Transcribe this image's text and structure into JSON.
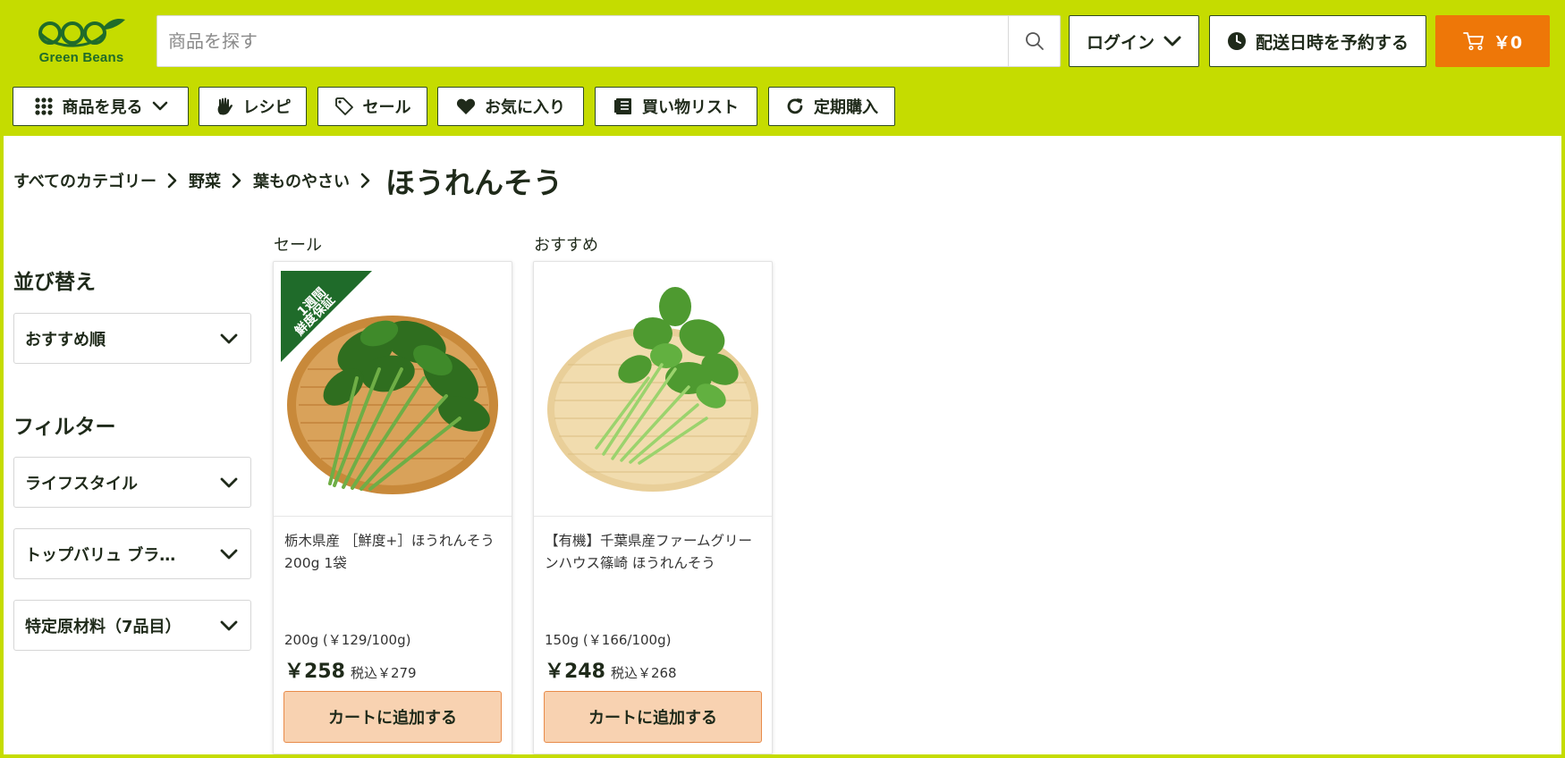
{
  "header": {
    "brand": "Green Beans",
    "search": {
      "placeholder": "商品を探す",
      "value": ""
    },
    "login_label": "ログイン",
    "reserve_label": "配送日時を予約する",
    "cart_total": "￥0"
  },
  "nav": [
    {
      "label": "商品を見る",
      "icon": "grid-icon"
    },
    {
      "label": "レシピ",
      "icon": "hand-icon"
    },
    {
      "label": "セール",
      "icon": "tag-icon"
    },
    {
      "label": "お気に入り",
      "icon": "heart-icon"
    },
    {
      "label": "買い物リスト",
      "icon": "list-icon"
    },
    {
      "label": "定期購入",
      "icon": "refresh-icon"
    }
  ],
  "breadcrumb": {
    "items": [
      "すべてのカテゴリー",
      "野菜",
      "葉ものやさい"
    ],
    "current": "ほうれんそう"
  },
  "sidebar": {
    "sort_heading": "並び替え",
    "sort_value": "おすすめ順",
    "filter_heading": "フィルター",
    "filters": [
      "ライフスタイル",
      "トップバリュ ブランド",
      "特定原材料（7品目）"
    ]
  },
  "products": [
    {
      "section_label": "セール",
      "badge": "1週間 鮮度保証",
      "name": "栃木県産 ［鮮度+］ほうれんそう 200g 1袋",
      "unit": "200g (￥129/100g)",
      "price": "￥258",
      "tax_price": "税込￥279",
      "button": "カートに追加する"
    },
    {
      "section_label": "おすすめ",
      "name": "【有機】千葉県産ファームグリーンハウス篠崎 ほうれんそう",
      "unit": "150g (￥166/100g)",
      "price": "￥248",
      "tax_price": "税込￥268",
      "button": "カートに追加する"
    }
  ],
  "colors": {
    "brand_lime": "#c5dc00",
    "brand_green": "#1f6b2a",
    "cart_orange": "#ee7708",
    "add_button_bg": "#f8d2b1"
  }
}
